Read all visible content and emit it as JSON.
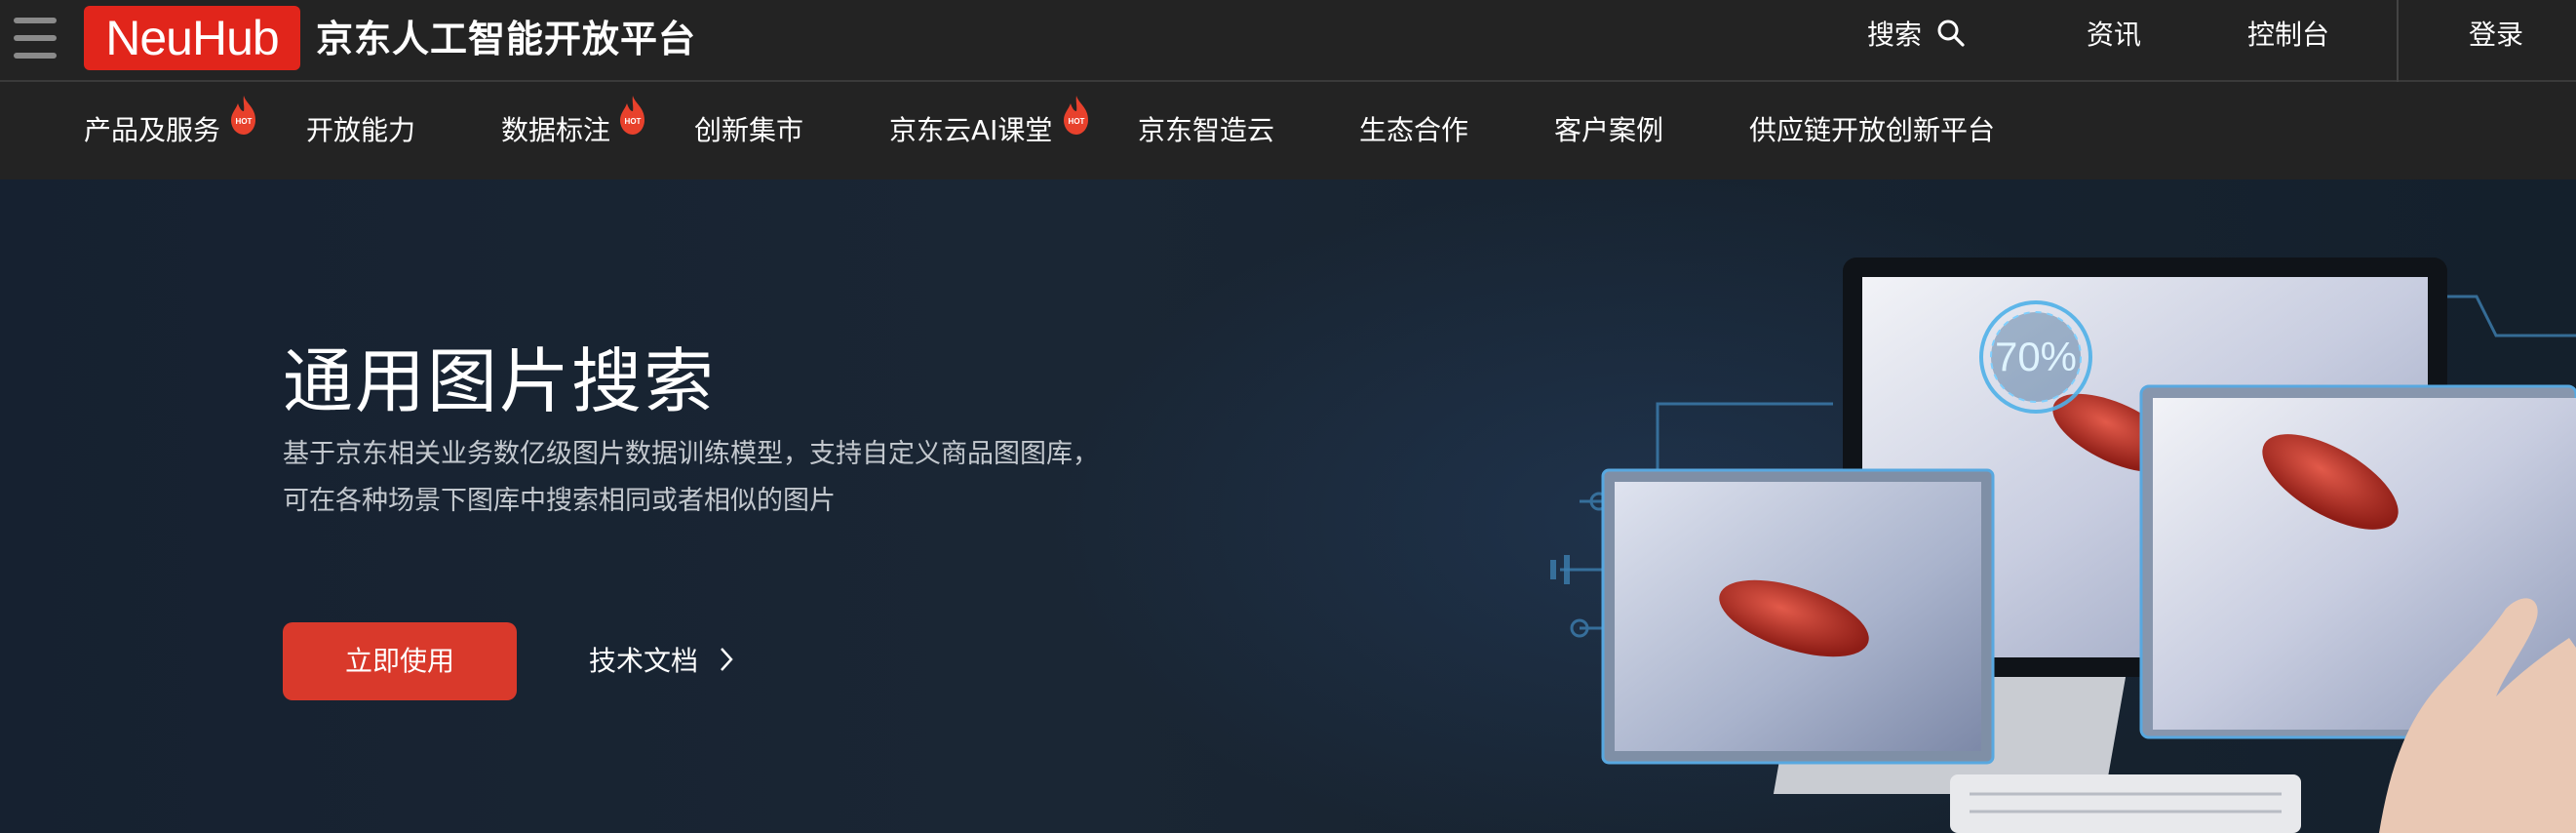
{
  "header": {
    "logo_text": "NeuHub",
    "site_title": "京东人工智能开放平台",
    "search_label": "搜索",
    "news_label": "资讯",
    "console_label": "控制台",
    "login_label": "登录"
  },
  "nav": {
    "items": [
      {
        "label": "产品及服务",
        "hot": true
      },
      {
        "label": "开放能力",
        "hot": false
      },
      {
        "label": "数据标注",
        "hot": true
      },
      {
        "label": "创新集市",
        "hot": false
      },
      {
        "label": "京东云AI课堂",
        "hot": true
      },
      {
        "label": "京东智造云",
        "hot": false
      },
      {
        "label": "生态合作",
        "hot": false
      },
      {
        "label": "客户案例",
        "hot": false
      },
      {
        "label": "供应链开放创新平台",
        "hot": false
      }
    ],
    "hot_badge": "HOT"
  },
  "hero": {
    "title": "通用图片搜索",
    "description": "基于京东相关业务数亿级图片数据训练模型，支持自定义商品图图库，可在各种场景下图库中搜索相同或者相似的图片",
    "primary_button": "立即使用",
    "doc_link": "技术文档",
    "illustration_percent": "70%"
  },
  "colors": {
    "brand_red": "#e1251b",
    "button_red": "#d9392b",
    "bar_bg": "#232323",
    "hero_bg": "#18222e"
  },
  "icons": [
    "menu-icon",
    "search-icon",
    "hot-flame-icon",
    "chevron-right-icon"
  ]
}
